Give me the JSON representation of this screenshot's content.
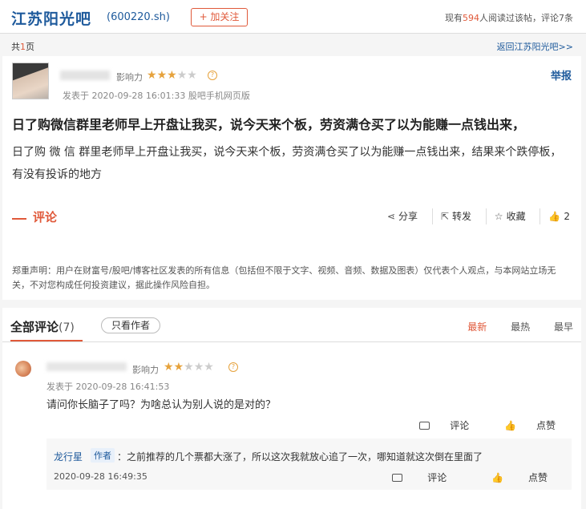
{
  "header": {
    "title": "江苏阳光吧",
    "code": "(600220.sh)",
    "follow_label": "+ 加关注",
    "read_prefix": "现有",
    "read_count": "594",
    "read_suffix": "人阅读过该帖，评论7条"
  },
  "pagebar": {
    "pages_prefix": "共",
    "pages_num": "1",
    "pages_suffix": "页",
    "back_link": "返回江苏阳光吧>>"
  },
  "post": {
    "influence_label": "影响力",
    "rating": 2.5,
    "report_label": "举报",
    "date": "发表于 2020-09-28 16:01:33 股吧手机网页版",
    "title": "日了购微信群里老师早上开盘让我买，说今天来个板，劳资满仓买了以为能赚一点钱出来，",
    "body": "日了购 微 信 群里老师早上开盘让我买，说今天来个板，劳资满仓买了以为能赚一点钱出来，结果来个跌停板，有没有投诉的地方",
    "comment_label": "评论",
    "share_label": "分享",
    "repost_label": "转发",
    "collect_label": "收藏",
    "like_count": "2",
    "disclaimer": "郑重声明：用户在财富号/股吧/博客社区发表的所有信息（包括但不限于文字、视频、音频、数据及图表）仅代表个人观点，与本网站立场无关，不对您构成任何投资建议，据此操作风险自担。"
  },
  "comments": {
    "title": "全部评论",
    "count": "(7)",
    "only_author": "只看作者",
    "sort": [
      "最新",
      "最热",
      "最早"
    ],
    "items": [
      {
        "influence_label": "影响力",
        "rating": 1.5,
        "date": "发表于 2020-09-28 16:41:53",
        "text": "请问你长脑子了吗？为啥总认为别人说的是对的？",
        "comment_label": "评论",
        "like_label": "点赞",
        "reply": {
          "name": "龙行星",
          "badge": "作者",
          "text": "：之前推荐的几个票都大涨了，所以这次我就放心追了一次，哪知道就这次倒在里面了",
          "date": "2020-09-28 16:49:35",
          "comment_label": "评论",
          "like_label": "点赞"
        }
      }
    ]
  }
}
